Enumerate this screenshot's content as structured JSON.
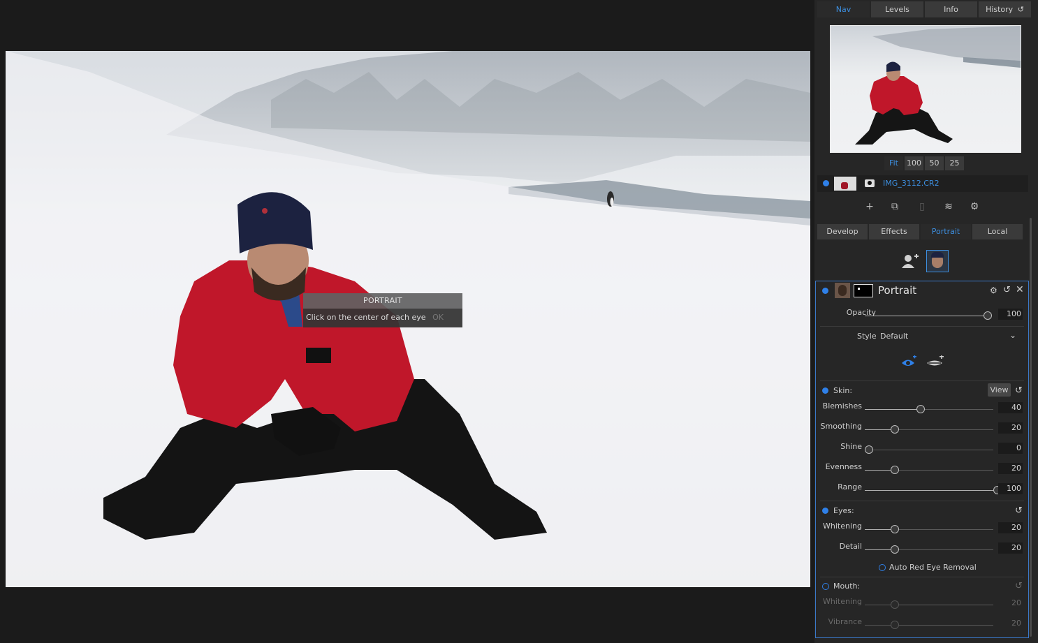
{
  "portrait_dialog": {
    "title": "PORTRAIT",
    "message": "Click on the center of each eye",
    "ok_label": "OK"
  },
  "nav_tabs": [
    "Nav",
    "Levels",
    "Info",
    "History"
  ],
  "zoom_options": [
    "Fit",
    "100",
    "50",
    "25"
  ],
  "layer": {
    "name": "IMG_3112.CR2"
  },
  "module_tabs": [
    "Develop",
    "Effects",
    "Portrait",
    "Local"
  ],
  "portrait": {
    "title": "Portrait",
    "opacity_label": "Opacity",
    "opacity_value": "100",
    "style_label": "Style",
    "style_value": "Default",
    "skin": {
      "label": "Skin:",
      "view_label": "View",
      "sliders": [
        {
          "label": "Blemishes",
          "value": "40"
        },
        {
          "label": "Smoothing",
          "value": "20"
        },
        {
          "label": "Shine",
          "value": "0"
        },
        {
          "label": "Evenness",
          "value": "20"
        },
        {
          "label": "Range",
          "value": "100"
        }
      ]
    },
    "eyes": {
      "label": "Eyes:",
      "sliders": [
        {
          "label": "Whitening",
          "value": "20"
        },
        {
          "label": "Detail",
          "value": "20"
        }
      ],
      "auto_red_eye_label": "Auto Red Eye Removal"
    },
    "mouth": {
      "label": "Mouth:",
      "sliders": [
        {
          "label": "Whitening",
          "value": "20"
        },
        {
          "label": "Vibrance",
          "value": "20"
        }
      ]
    }
  },
  "colors": {
    "accent": "#2f80e8",
    "panel_bg": "#262626",
    "tab_bg": "#3a3a3a"
  }
}
